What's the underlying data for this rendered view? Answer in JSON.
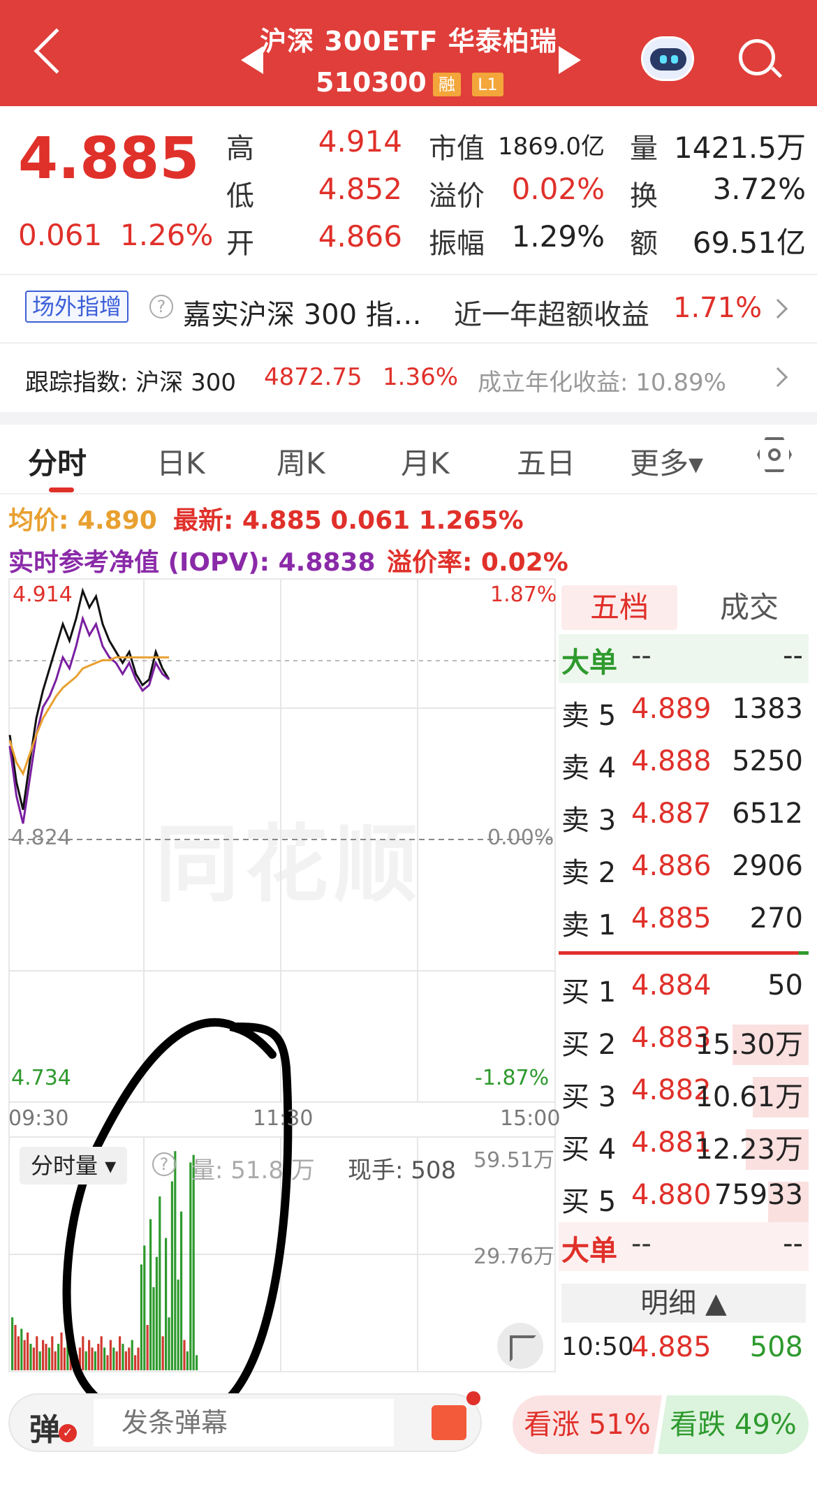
{
  "header": {
    "title": "沪深 300ETF 华泰柏瑞",
    "code": "510300",
    "badge_margin": "融",
    "badge_level": "L1"
  },
  "quote": {
    "price": "4.885",
    "change": "0.061",
    "change_pct": "1.26%",
    "high_label": "高",
    "high": "4.914",
    "low_label": "低",
    "low": "4.852",
    "open_label": "开",
    "open": "4.866",
    "mktcap_label": "市值",
    "mktcap": "1869.0亿",
    "premium_label": "溢价",
    "premium": "0.02%",
    "amplitude_label": "振幅",
    "amplitude": "1.29%",
    "volume_label": "量",
    "volume": "1421.5万",
    "turnover_label": "换",
    "turnover": "3.72%",
    "amount_label": "额",
    "amount": "69.51亿"
  },
  "fund_row": {
    "tag": "场外指增",
    "help": "?",
    "fund_name": "嘉实沪深 300 指…",
    "excess_label": "近一年超额收益",
    "excess_value": "1.71%"
  },
  "index_row": {
    "label": "跟踪指数: 沪深 300",
    "value": "4872.75",
    "pct": "1.36%",
    "annual": "成立年化收益: 10.89%"
  },
  "tabs": [
    "分时",
    "日K",
    "周K",
    "月K",
    "五日",
    "更多▾"
  ],
  "info": {
    "avg": "均价: 4.890",
    "latest": "最新: 4.885  0.061  1.265%",
    "iopv": "实时参考净值 (IOPV): 4.8838",
    "premium_rate": "溢价率: 0.02%"
  },
  "axis": {
    "price_high": "4.914",
    "price_mid": "4.824",
    "price_low": "4.734",
    "pct_high": "1.87%",
    "pct_mid": "0.00%",
    "pct_low": "-1.87%",
    "time_start": "09:30",
    "time_mid": "11:30",
    "time_end": "15:00",
    "vol_high": "59.51万",
    "vol_mid": "29.76万"
  },
  "watermark": "同花顺",
  "volume_panel": {
    "selector": "分时量 ▾",
    "help": "?",
    "volume": "量: 51.8 万",
    "hand": "现手: 508"
  },
  "orderbook": {
    "tab_five": "五档",
    "tab_trades": "成交",
    "big_sell": {
      "label": "大单",
      "price": "--",
      "vol": "--"
    },
    "asks": [
      {
        "label": "卖 5",
        "price": "4.889",
        "vol": "1383"
      },
      {
        "label": "卖 4",
        "price": "4.888",
        "vol": "5250"
      },
      {
        "label": "卖 3",
        "price": "4.887",
        "vol": "6512"
      },
      {
        "label": "卖 2",
        "price": "4.886",
        "vol": "2906"
      },
      {
        "label": "卖 1",
        "price": "4.885",
        "vol": "270"
      }
    ],
    "bids": [
      {
        "label": "买 1",
        "price": "4.884",
        "vol": "50",
        "level": 0
      },
      {
        "label": "买 2",
        "price": "4.883",
        "vol": "15.30万",
        "level": 0.75
      },
      {
        "label": "买 3",
        "price": "4.882",
        "vol": "10.61万",
        "level": 0.55
      },
      {
        "label": "买 4",
        "price": "4.881",
        "vol": "12.23万",
        "level": 0.62
      },
      {
        "label": "买 5",
        "price": "4.880",
        "vol": "75933",
        "level": 0.4
      }
    ],
    "big_buy": {
      "label": "大单",
      "price": "--",
      "vol": "--"
    },
    "detail": "明细 ▲",
    "last_trade": {
      "time": "10:50",
      "price": "4.885",
      "vol": "508"
    }
  },
  "bottom": {
    "danmu_icon": "弹",
    "danmu_placeholder": "发条弹幕",
    "bull": "看涨 51%",
    "bear": "看跌 49%"
  },
  "chart_data": {
    "type": "line",
    "x_range": [
      "09:30",
      "15:00"
    ],
    "ylim": [
      4.734,
      4.914
    ],
    "series": [
      {
        "values": [
          4.862,
          4.845,
          4.835,
          4.852,
          4.868,
          4.878,
          4.886,
          4.894,
          4.902,
          4.896,
          4.904,
          4.914,
          4.908,
          4.912,
          4.902,
          4.896,
          4.892,
          4.888,
          4.892,
          4.884,
          4.88,
          4.882,
          4.892,
          4.886,
          4.882
        ]
      },
      {
        "values": [
          4.858,
          4.84,
          4.83,
          4.846,
          4.862,
          4.872,
          4.876,
          4.882,
          4.89,
          4.886,
          4.894,
          4.904,
          4.898,
          4.902,
          4.894,
          4.89,
          4.888,
          4.884,
          4.888,
          4.882,
          4.878,
          4.88,
          4.888,
          4.884,
          4.882
        ]
      },
      {
        "values": [
          4.86,
          4.852,
          4.848,
          4.855,
          4.862,
          4.868,
          4.872,
          4.876,
          4.879,
          4.881,
          4.883,
          4.886,
          4.887,
          4.888,
          4.889,
          4.889,
          4.89,
          4.89,
          4.89,
          4.89,
          4.89,
          4.89,
          4.89,
          4.89,
          4.89
        ]
      }
    ],
    "volume": {
      "ylim": [
        0,
        59.51
      ],
      "values": [
        14,
        12,
        9,
        11,
        8,
        10,
        7,
        6,
        9,
        5,
        8,
        7,
        6,
        9,
        5,
        7,
        10,
        6,
        8,
        5,
        7,
        4,
        6,
        9,
        5,
        8,
        6,
        5,
        7,
        9,
        6,
        4,
        8,
        6,
        5,
        9,
        7,
        5,
        6,
        8,
        4,
        6,
        28,
        33,
        12,
        40,
        22,
        30,
        46,
        9,
        35,
        14,
        50,
        58,
        24,
        42,
        8,
        5,
        55,
        57,
        4
      ]
    }
  }
}
